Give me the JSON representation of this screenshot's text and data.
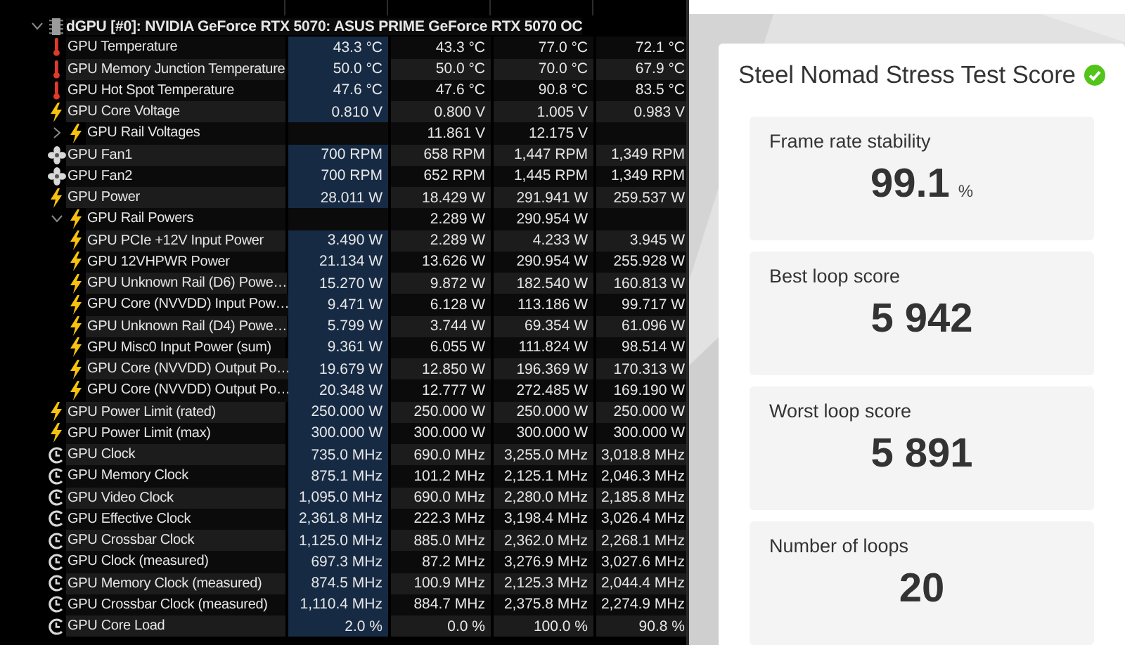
{
  "sensor_tree": {
    "device": {
      "label": "dGPU [#0]: NVIDIA GeForce RTX 5070: ASUS PRIME GeForce RTX 5070 OC",
      "expanded": true,
      "children": [
        {
          "kind": "temperature",
          "label": "GPU Temperature",
          "values": [
            "43.3 °C",
            "43.3 °C",
            "77.0 °C",
            "72.1 °C"
          ]
        },
        {
          "kind": "temperature",
          "label": "GPU Memory Junction Temperature",
          "values": [
            "50.0 °C",
            "50.0 °C",
            "70.0 °C",
            "67.9 °C"
          ]
        },
        {
          "kind": "temperature",
          "label": "GPU Hot Spot Temperature",
          "values": [
            "47.6 °C",
            "47.6 °C",
            "90.8 °C",
            "83.5 °C"
          ]
        },
        {
          "kind": "electric",
          "label": "GPU Core Voltage",
          "values": [
            "0.810 V",
            "0.800 V",
            "1.005 V",
            "0.983 V"
          ]
        },
        {
          "kind": "electric",
          "label": "GPU Rail Voltages",
          "expanded": false,
          "values": {
            "column_2": "11.861 V",
            "column_3": "12.175 V"
          }
        },
        {
          "kind": "fan",
          "label": "GPU Fan1",
          "values": [
            "700 RPM",
            "658 RPM",
            "1,447 RPM",
            "1,349 RPM"
          ]
        },
        {
          "kind": "fan",
          "label": "GPU Fan2",
          "values": [
            "700 RPM",
            "652 RPM",
            "1,445 RPM",
            "1,349 RPM"
          ]
        },
        {
          "kind": "electric",
          "label": "GPU Power",
          "values": [
            "28.011 W",
            "18.429 W",
            "291.941 W",
            "259.537 W"
          ]
        },
        {
          "kind": "electric",
          "label": "GPU Rail Powers",
          "expanded": true,
          "values": {
            "column_2": "2.289 W",
            "column_3": "290.954 W"
          },
          "children": [
            {
              "kind": "electric",
              "label": "GPU PCIe +12V Input Power",
              "values": [
                "3.490 W",
                "2.289 W",
                "4.233 W",
                "3.945 W"
              ]
            },
            {
              "kind": "electric",
              "label": "GPU 12VHPWR Power",
              "values": [
                "21.134 W",
                "13.626 W",
                "290.954 W",
                "255.928 W"
              ]
            },
            {
              "kind": "electric",
              "label": "GPU Unknown Rail (D6) Powe…",
              "values": [
                "15.270 W",
                "9.872 W",
                "182.540 W",
                "160.813 W"
              ]
            },
            {
              "kind": "electric",
              "label": "GPU Core (NVVDD) Input Pow…",
              "values": [
                "9.471 W",
                "6.128 W",
                "113.186 W",
                "99.717 W"
              ]
            },
            {
              "kind": "electric",
              "label": "GPU Unknown Rail (D4) Powe…",
              "values": [
                "5.799 W",
                "3.744 W",
                "69.354 W",
                "61.096 W"
              ]
            },
            {
              "kind": "electric",
              "label": "GPU Misc0 Input Power (sum)",
              "values": [
                "9.361 W",
                "6.055 W",
                "111.824 W",
                "98.514 W"
              ]
            },
            {
              "kind": "electric",
              "label": "GPU Core (NVVDD) Output Po…",
              "values": [
                "19.679 W",
                "12.850 W",
                "196.369 W",
                "170.313 W"
              ]
            },
            {
              "kind": "electric",
              "label": "GPU Core (NVVDD) Output Po…",
              "values": [
                "20.348 W",
                "12.777 W",
                "272.485 W",
                "169.190 W"
              ]
            }
          ]
        },
        {
          "kind": "electric",
          "label": "GPU Power Limit (rated)",
          "values": [
            "250.000 W",
            "250.000 W",
            "250.000 W",
            "250.000 W"
          ]
        },
        {
          "kind": "electric",
          "label": "GPU Power Limit (max)",
          "values": [
            "300.000 W",
            "300.000 W",
            "300.000 W",
            "300.000 W"
          ]
        },
        {
          "kind": "clock",
          "label": "GPU Clock",
          "values": [
            "735.0 MHz",
            "690.0 MHz",
            "3,255.0 MHz",
            "3,018.8 MHz"
          ]
        },
        {
          "kind": "clock",
          "label": "GPU Memory Clock",
          "values": [
            "875.1 MHz",
            "101.2 MHz",
            "2,125.1 MHz",
            "2,046.3 MHz"
          ]
        },
        {
          "kind": "clock",
          "label": "GPU Video Clock",
          "values": [
            "1,095.0 MHz",
            "690.0 MHz",
            "2,280.0 MHz",
            "2,185.8 MHz"
          ]
        },
        {
          "kind": "clock",
          "label": "GPU Effective Clock",
          "values": [
            "2,361.8 MHz",
            "222.3 MHz",
            "3,198.4 MHz",
            "3,026.4 MHz"
          ]
        },
        {
          "kind": "clock",
          "label": "GPU Crossbar Clock",
          "values": [
            "1,125.0 MHz",
            "885.0 MHz",
            "2,362.0 MHz",
            "2,268.1 MHz"
          ]
        },
        {
          "kind": "clock",
          "label": "GPU Clock (measured)",
          "values": [
            "697.3 MHz",
            "87.2 MHz",
            "3,276.9 MHz",
            "3,027.6 MHz"
          ]
        },
        {
          "kind": "clock",
          "label": "GPU Memory Clock (measured)",
          "values": [
            "874.5 MHz",
            "100.9 MHz",
            "2,125.3 MHz",
            "2,044.4 MHz"
          ]
        },
        {
          "kind": "clock",
          "label": "GPU Crossbar Clock (measured)",
          "values": [
            "1,110.4 MHz",
            "884.7 MHz",
            "2,375.8 MHz",
            "2,274.9 MHz"
          ]
        },
        {
          "kind": "clock",
          "label": "GPU Core Load",
          "values": [
            "2.0 %",
            "0.0 %",
            "100.0 %",
            "90.8 %"
          ]
        }
      ]
    }
  },
  "score_panel": {
    "title": "Steel Nomad Stress Test Score",
    "passed": true,
    "metrics": [
      {
        "label": "Frame rate stability",
        "value": "99.1",
        "unit": "%"
      },
      {
        "label": "Best loop score",
        "value": "5 942"
      },
      {
        "label": "Worst loop score",
        "value": "5 891"
      },
      {
        "label": "Number of loops",
        "value": "20"
      }
    ]
  }
}
